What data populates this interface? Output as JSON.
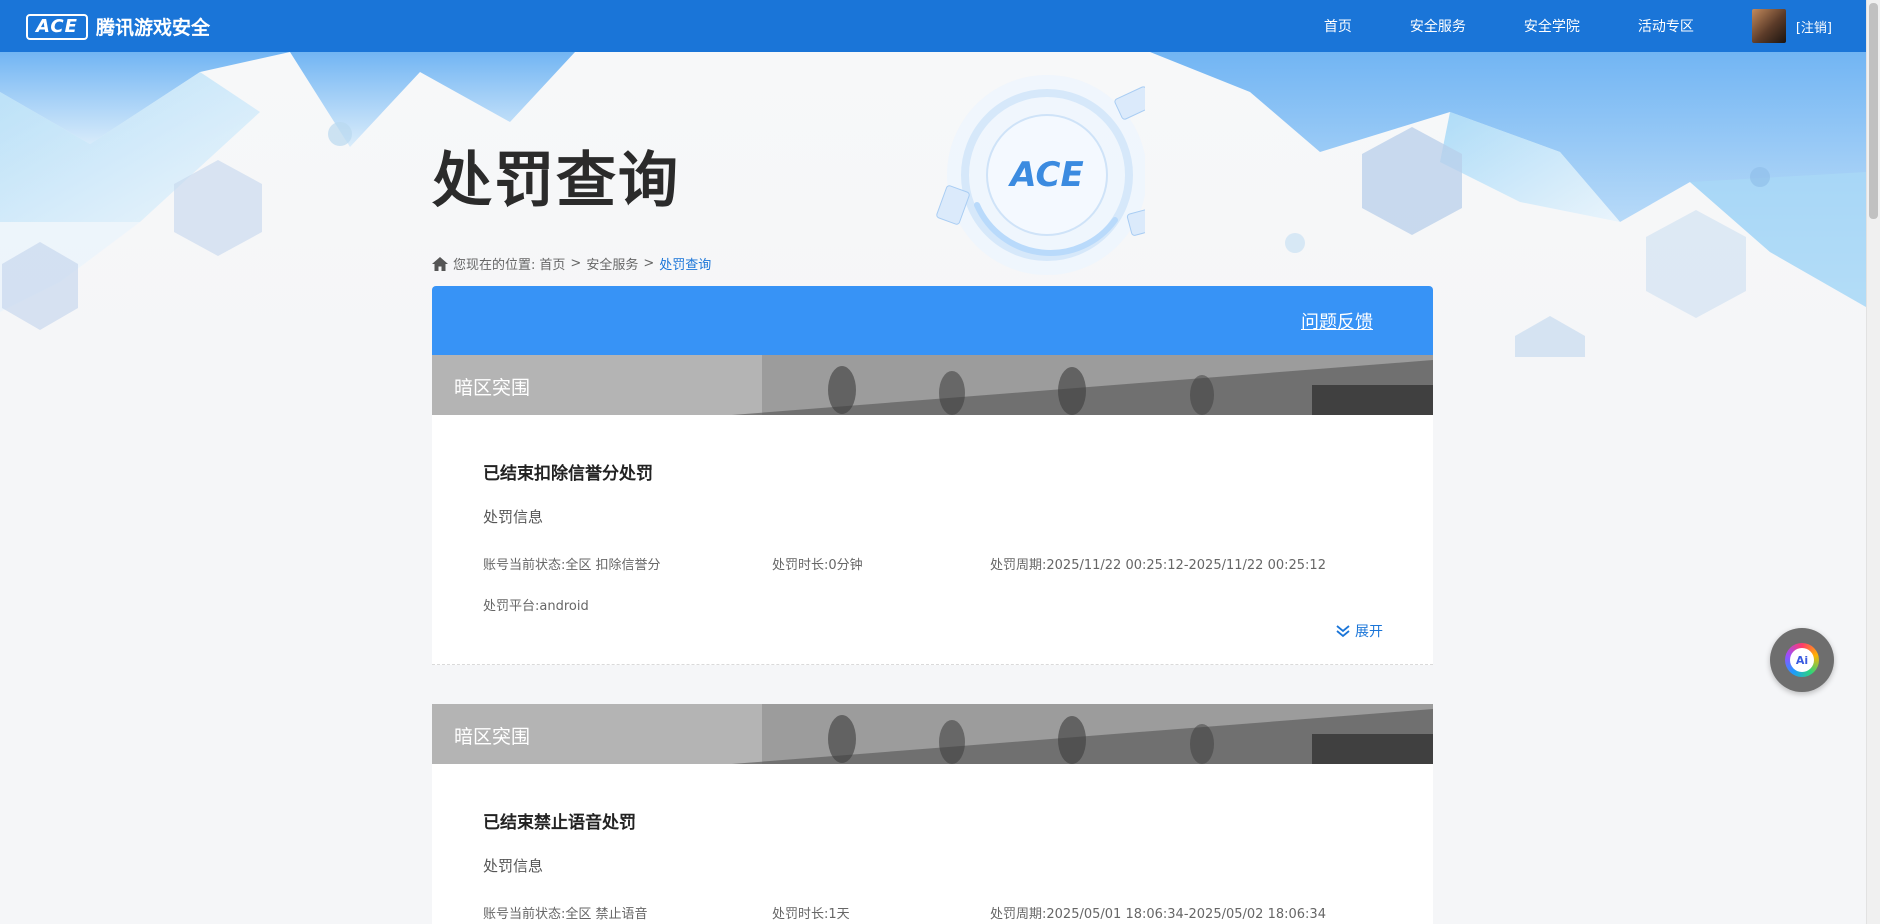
{
  "header": {
    "logo_mark": "ACE",
    "logo_text": "腾讯游戏安全",
    "nav": [
      "首页",
      "安全服务",
      "安全学院",
      "活动专区"
    ],
    "logout": "[注销]"
  },
  "hero": {
    "title": "处罚查询"
  },
  "breadcrumb": {
    "prefix": "您现在的位置:",
    "items": [
      "首页",
      "安全服务"
    ],
    "separator": ">",
    "current": "处罚查询"
  },
  "card": {
    "feedback": "问题反馈"
  },
  "records": [
    {
      "game": "暗区突围",
      "title": "已结束扣除信誉分处罚",
      "info_label": "处罚信息",
      "status": "账号当前状态:全区 扣除信誉分",
      "duration": "处罚时长:0分钟",
      "period": "处罚周期:2025/11/22 00:25:12-2025/11/22 00:25:12",
      "platform": "处罚平台:android",
      "expand": "展开"
    },
    {
      "game": "暗区突围",
      "title": "已结束禁止语音处罚",
      "info_label": "处罚信息",
      "status": "账号当前状态:全区 禁止语音",
      "duration": "处罚时长:1天",
      "period": "处罚周期:2025/05/01 18:06:34-2025/05/02 18:06:34"
    }
  ],
  "ai_button": "Ai",
  "colors": {
    "nav_bg": "#1a75d8",
    "card_header": "#3793f6",
    "link": "#1a75d8"
  }
}
